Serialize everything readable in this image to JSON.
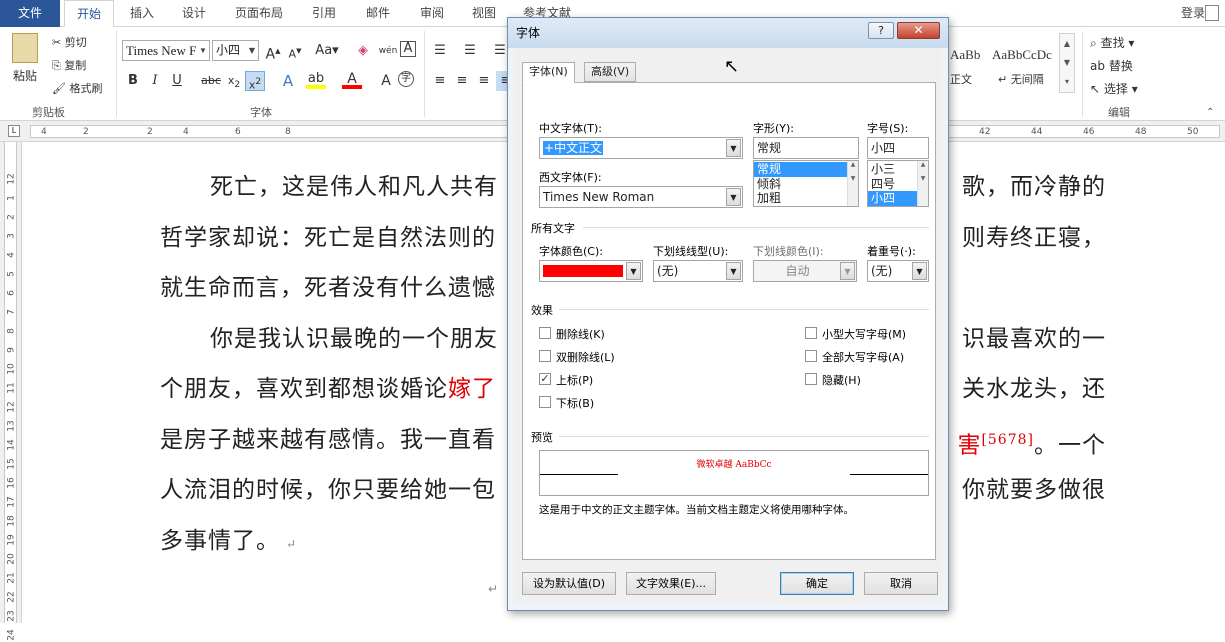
{
  "tabs": {
    "file": "文件",
    "home": "开始",
    "insert": "插入",
    "design": "设计",
    "layout": "页面布局",
    "references": "引用",
    "mailings": "邮件",
    "review": "审阅",
    "view": "视图",
    "ref_doc": "参考文献",
    "login": "登录"
  },
  "ribbon": {
    "cut": "剪切",
    "copy": "复制",
    "format_painter": "格式刷",
    "paste": "粘贴",
    "clipboard_label": "剪贴板",
    "font_name": "Times New F",
    "font_size": "小四",
    "font_label": "字体",
    "style_1": "AaBbCcDc",
    "style_2": "AaBbCcDc",
    "style_1_name": "正文",
    "style_2_name": "↵ 无间隔",
    "find": "查找",
    "replace": "替换",
    "select": "选择",
    "edit_label": "编辑"
  },
  "ruler": {
    "h_numbers": [
      "4",
      "2",
      "2",
      "4",
      "6",
      "8",
      "40",
      "42",
      "44",
      "46",
      "48",
      "50",
      "52"
    ],
    "v_numbers": [
      "12",
      "1",
      "2",
      "3",
      "4",
      "5",
      "6",
      "7",
      "8",
      "9",
      "10",
      "11",
      "12",
      "13",
      "14",
      "15",
      "16",
      "17",
      "18",
      "19",
      "20",
      "21",
      "22",
      "23",
      "24"
    ]
  },
  "document": {
    "lines": [
      {
        "indent": true,
        "parts": [
          {
            "text": "死亡，这是伟人和凡人共有",
            "red": false
          },
          {
            "text": "",
            "red": false
          },
          {
            "text": "歌，而冷静的",
            "red": false,
            "right": true
          }
        ]
      },
      {
        "indent": false,
        "parts": [
          {
            "text": "哲学家却说：死亡是自然法则的",
            "red": false
          },
          {
            "text": "则寿终正寝，",
            "red": false,
            "right": true
          }
        ]
      },
      {
        "indent": false,
        "parts": [
          {
            "text": "就生命而言，死者没有什么遗憾",
            "red": false
          }
        ]
      },
      {
        "indent": true,
        "parts": [
          {
            "text": "你是我认识最晚的一个朋友",
            "red": false
          },
          {
            "text": "识最喜欢的一",
            "red": false,
            "right": true
          }
        ]
      },
      {
        "indent": false,
        "parts": [
          {
            "text": "个朋友，喜欢到都想谈婚论",
            "red": false
          },
          {
            "text": "嫁了",
            "red": true
          },
          {
            "text": "关水龙头，还",
            "red": false,
            "right": true
          }
        ]
      },
      {
        "indent": false,
        "parts": [
          {
            "text": "是房子越来越有感情。我一直看",
            "red": false
          },
          {
            "text": "害",
            "red": true,
            "right": true,
            "sup": "[5678]",
            "tail": "。一个"
          }
        ]
      },
      {
        "indent": false,
        "parts": [
          {
            "text": "人流泪的时候，你只要给她一包",
            "red": false
          },
          {
            "text": "你就要多做很",
            "red": false,
            "right": true
          }
        ]
      },
      {
        "indent": false,
        "parts": [
          {
            "text": "多事情了。",
            "red": false
          }
        ]
      }
    ],
    "return_mark": "↵"
  },
  "dialog": {
    "title": "字体",
    "tab_font": "字体(N)",
    "tab_advanced": "高级(V)",
    "cn_font_label": "中文字体(T):",
    "cn_font_value": "+中文正文",
    "western_font_label": "西文字体(F):",
    "western_font_value": "Times New Roman",
    "style_label": "字形(Y):",
    "style_value": "常规",
    "style_options": [
      "常规",
      "倾斜",
      "加粗"
    ],
    "style_selected_index": 0,
    "size_label": "字号(S):",
    "size_value": "小四",
    "size_options": [
      "小三",
      "四号",
      "小四"
    ],
    "size_selected_index": 2,
    "all_text_label": "所有文字",
    "font_color_label": "字体颜色(C):",
    "font_color": "#ff0000",
    "underline_type_label": "下划线线型(U):",
    "underline_type_value": "(无)",
    "underline_color_label": "下划线颜色(I):",
    "underline_color_value": "自动",
    "emphasis_label": "着重号(·):",
    "emphasis_value": "(无)",
    "effects_label": "效果",
    "effects_left": [
      {
        "label": "删除线(K)",
        "checked": false
      },
      {
        "label": "双删除线(L)",
        "checked": false
      },
      {
        "label": "上标(P)",
        "checked": true
      },
      {
        "label": "下标(B)",
        "checked": false
      }
    ],
    "effects_right": [
      {
        "label": "小型大写字母(M)",
        "checked": false
      },
      {
        "label": "全部大写字母(A)",
        "checked": false
      },
      {
        "label": "隐藏(H)",
        "checked": false
      }
    ],
    "preview_label": "预览",
    "preview_text": "微软卓越 AaBbCc",
    "preview_note": "这是用于中文的正文主题字体。当前文档主题定义将使用哪种字体。",
    "set_default": "设为默认值(D)",
    "text_effects": "文字效果(E)...",
    "ok": "确定",
    "cancel": "取消"
  }
}
